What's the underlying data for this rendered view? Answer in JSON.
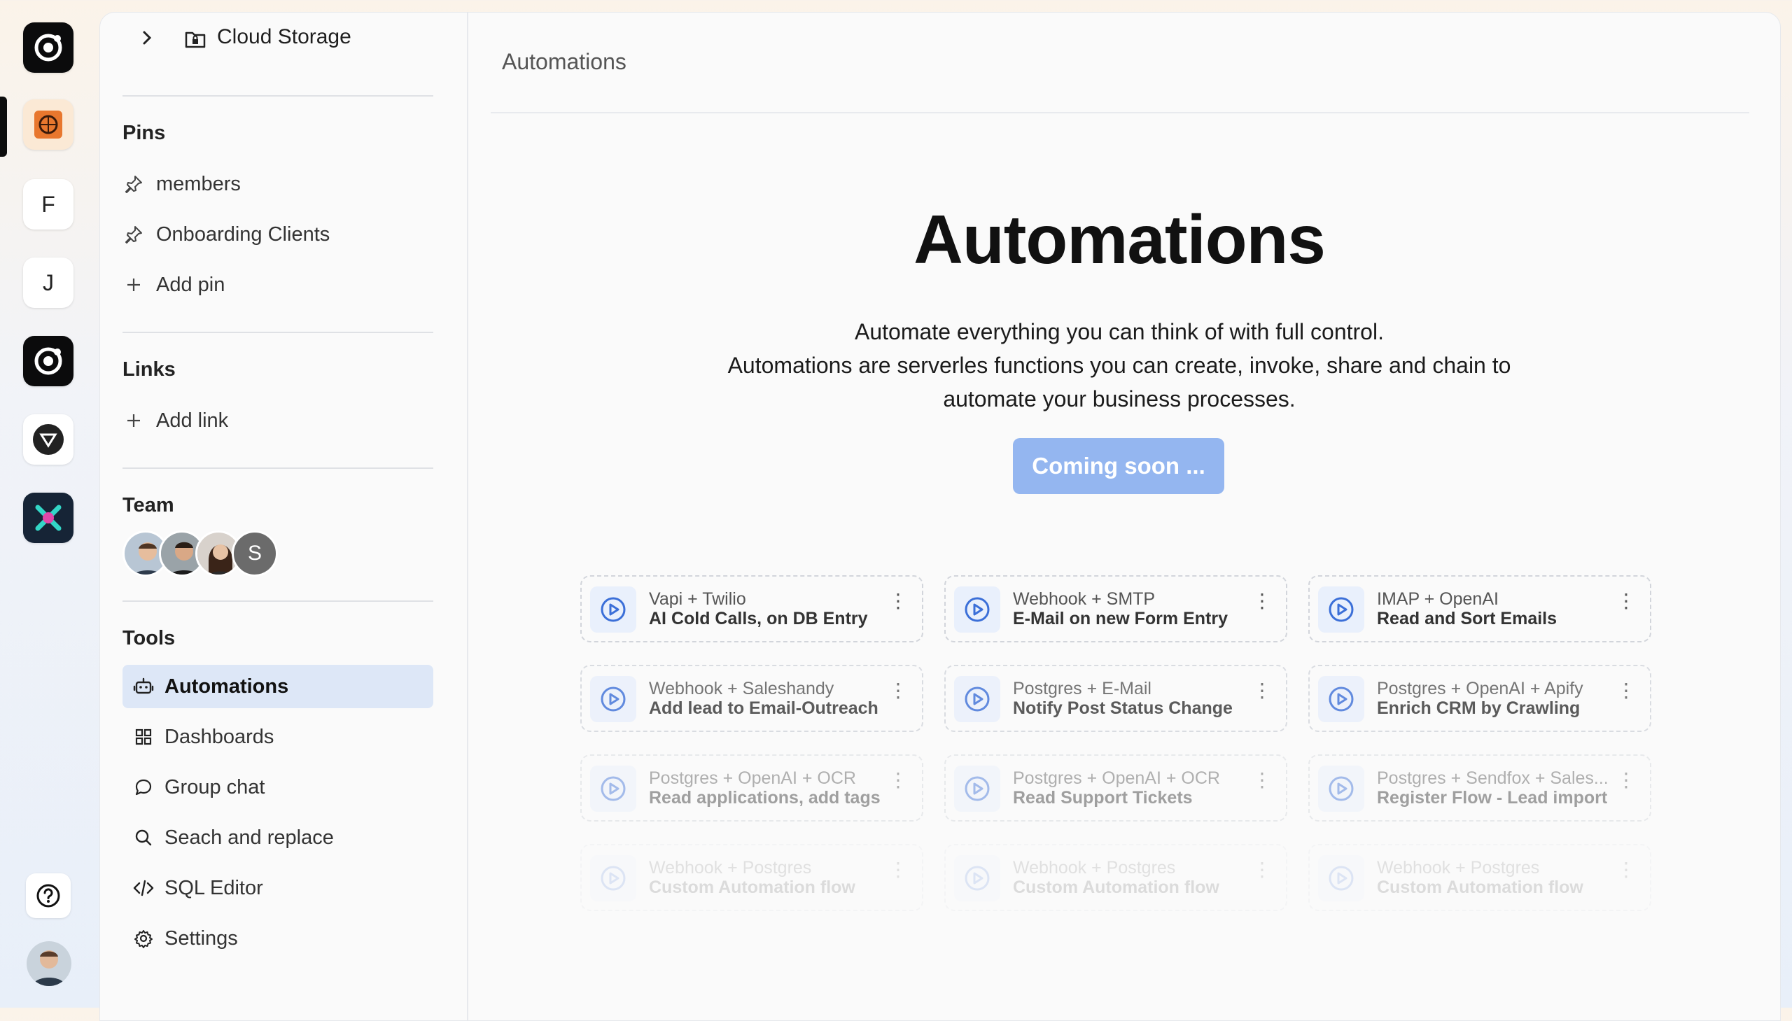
{
  "rail": {
    "letters": [
      "F",
      "J"
    ]
  },
  "sidebar": {
    "title": "Cloud Storage",
    "pins_title": "Pins",
    "pins": [
      "members",
      "Onboarding Clients"
    ],
    "add_pin": "Add pin",
    "links_title": "Links",
    "add_link": "Add link",
    "team_title": "Team",
    "team_initial": "S",
    "tools_title": "Tools",
    "tools": [
      "Automations",
      "Dashboards",
      "Group chat",
      "Seach and replace",
      "SQL Editor",
      "Settings"
    ]
  },
  "main": {
    "breadcrumb": "Automations",
    "title": "Automations",
    "desc_line1": "Automate everything you can think of with full control.",
    "desc_line2": "Automations are serverles functions you can create, invoke, share and chain to",
    "desc_line3": "automate your business processes.",
    "cta": "Coming soon ...",
    "cards": [
      {
        "stack": "Vapi + Twilio",
        "title": "AI Cold Calls, on  DB Entry"
      },
      {
        "stack": "Webhook + SMTP",
        "title": "E-Mail on new Form Entry"
      },
      {
        "stack": "IMAP + OpenAI",
        "title": "Read and Sort Emails"
      },
      {
        "stack": "Webhook + Saleshandy",
        "title": "Add lead to Email-Outreach"
      },
      {
        "stack": "Postgres + E-Mail",
        "title": "Notify Post Status Change"
      },
      {
        "stack": "Postgres + OpenAI + Apify",
        "title": "Enrich CRM by Crawling"
      },
      {
        "stack": "Postgres + OpenAI + OCR",
        "title": "Read applications, add tags"
      },
      {
        "stack": "Postgres + OpenAI + OCR",
        "title": "Read Support Tickets"
      },
      {
        "stack": "Postgres + Sendfox + Sales...",
        "title": "Register Flow - Lead import"
      },
      {
        "stack": "Webhook + Postgres",
        "title": "Custom Automation flow"
      },
      {
        "stack": "Webhook + Postgres",
        "title": "Custom Automation flow"
      },
      {
        "stack": "Webhook + Postgres",
        "title": "Custom Automation flow"
      }
    ]
  },
  "colors": {
    "accent": "#94b6f0",
    "active_tool_bg": "#dde7f7",
    "play_icon": "#3b6fd8"
  }
}
